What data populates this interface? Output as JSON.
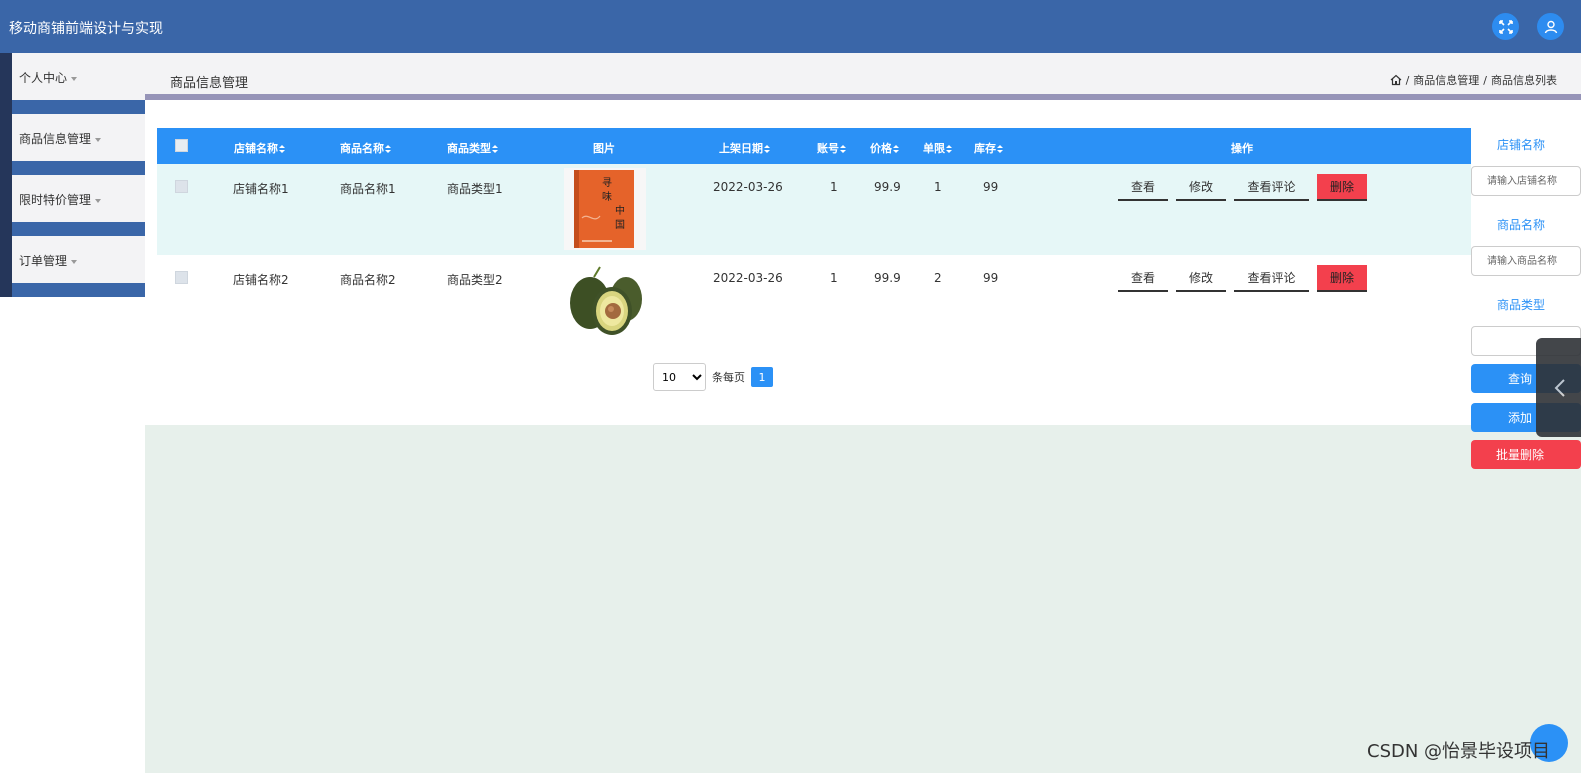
{
  "header": {
    "app_title": "移动商铺前端设计与实现",
    "accent": "#3a66a8"
  },
  "sidebar": {
    "items": [
      {
        "label": "个人中心"
      },
      {
        "label": "商品信息管理"
      },
      {
        "label": "限时特价管理"
      },
      {
        "label": "订单管理"
      }
    ]
  },
  "breadcrumb": {
    "page_title": "商品信息管理",
    "sep": "/",
    "level1": "商品信息管理",
    "level2": "商品信息列表"
  },
  "table": {
    "columns": [
      "店铺名称",
      "商品名称",
      "商品类型",
      "图片",
      "上架日期",
      "账号",
      "价格",
      "单限",
      "库存",
      "操作"
    ],
    "rows": [
      {
        "shop": "店铺名称1",
        "name": "商品名称1",
        "type": "商品类型1",
        "image": "book-cover",
        "date": "2022-03-26",
        "account": "1",
        "price": "99.9",
        "limit": "1",
        "stock": "99"
      },
      {
        "shop": "店铺名称2",
        "name": "商品名称2",
        "type": "商品类型2",
        "image": "avocado",
        "date": "2022-03-26",
        "account": "1",
        "price": "99.9",
        "limit": "2",
        "stock": "99"
      }
    ],
    "actions": {
      "view": "查看",
      "edit": "修改",
      "comments": "查看评论",
      "delete": "删除"
    }
  },
  "pagination": {
    "page_size": "10",
    "per_page_label": "条每页",
    "current_page": "1"
  },
  "filter": {
    "shop_label": "店铺名称",
    "shop_placeholder": "请输入店铺名称",
    "name_label": "商品名称",
    "name_placeholder": "请输入商品名称",
    "type_label": "商品类型",
    "search_button": "查询",
    "add_button": "添加",
    "batch_delete_button": "批量删除"
  },
  "watermark": "CSDN @怡景毕设项目"
}
